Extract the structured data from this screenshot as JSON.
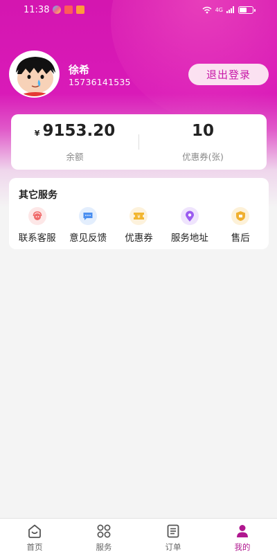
{
  "status_bar": {
    "time": "11:38",
    "signal": "4G"
  },
  "profile": {
    "name": "徐希",
    "phone": "15736141535",
    "logout_label": "退出登录"
  },
  "wallet": {
    "balance_symbol": "¥",
    "balance": "9153.20",
    "balance_label": "余额",
    "coupons": "10",
    "coupons_label": "优惠券(张)"
  },
  "services": {
    "title": "其它服务",
    "items": [
      {
        "label": "联系客服",
        "icon": "customer-service-icon",
        "color": "#f06a6a"
      },
      {
        "label": "意见反馈",
        "icon": "feedback-icon",
        "color": "#4a8ff0"
      },
      {
        "label": "优惠券",
        "icon": "coupon-icon",
        "color": "#f2b630"
      },
      {
        "label": "服务地址",
        "icon": "location-icon",
        "color": "#9b5cf0"
      },
      {
        "label": "售后",
        "icon": "after-sales-icon",
        "color": "#f0b030"
      }
    ]
  },
  "tabs": [
    {
      "label": "首页",
      "icon": "home-icon"
    },
    {
      "label": "服务",
      "icon": "services-grid-icon"
    },
    {
      "label": "订单",
      "icon": "orders-icon"
    },
    {
      "label": "我的",
      "icon": "profile-icon",
      "active": true
    }
  ],
  "colors": {
    "accent": "#c81aa8",
    "hero_start": "#d416b0"
  }
}
